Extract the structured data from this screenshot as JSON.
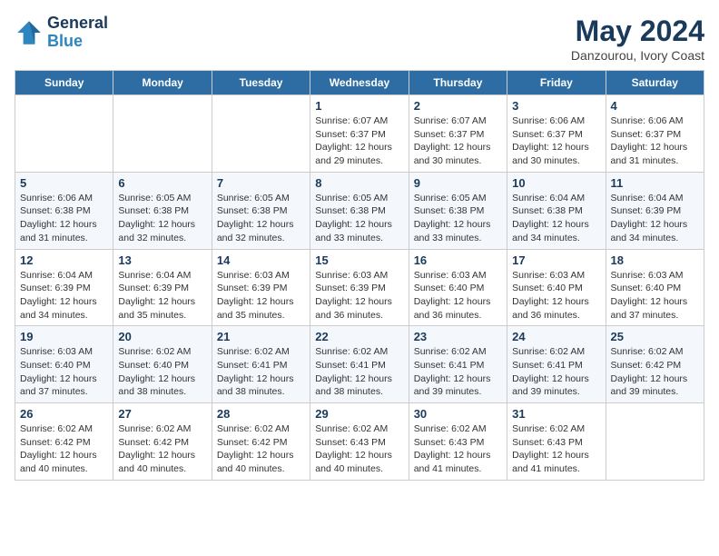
{
  "header": {
    "logo_line1": "General",
    "logo_line2": "Blue",
    "month": "May 2024",
    "location": "Danzourou, Ivory Coast"
  },
  "weekdays": [
    "Sunday",
    "Monday",
    "Tuesday",
    "Wednesday",
    "Thursday",
    "Friday",
    "Saturday"
  ],
  "weeks": [
    [
      {
        "day": "",
        "info": ""
      },
      {
        "day": "",
        "info": ""
      },
      {
        "day": "",
        "info": ""
      },
      {
        "day": "1",
        "info": "Sunrise: 6:07 AM\nSunset: 6:37 PM\nDaylight: 12 hours and 29 minutes."
      },
      {
        "day": "2",
        "info": "Sunrise: 6:07 AM\nSunset: 6:37 PM\nDaylight: 12 hours and 30 minutes."
      },
      {
        "day": "3",
        "info": "Sunrise: 6:06 AM\nSunset: 6:37 PM\nDaylight: 12 hours and 30 minutes."
      },
      {
        "day": "4",
        "info": "Sunrise: 6:06 AM\nSunset: 6:37 PM\nDaylight: 12 hours and 31 minutes."
      }
    ],
    [
      {
        "day": "5",
        "info": "Sunrise: 6:06 AM\nSunset: 6:38 PM\nDaylight: 12 hours and 31 minutes."
      },
      {
        "day": "6",
        "info": "Sunrise: 6:05 AM\nSunset: 6:38 PM\nDaylight: 12 hours and 32 minutes."
      },
      {
        "day": "7",
        "info": "Sunrise: 6:05 AM\nSunset: 6:38 PM\nDaylight: 12 hours and 32 minutes."
      },
      {
        "day": "8",
        "info": "Sunrise: 6:05 AM\nSunset: 6:38 PM\nDaylight: 12 hours and 33 minutes."
      },
      {
        "day": "9",
        "info": "Sunrise: 6:05 AM\nSunset: 6:38 PM\nDaylight: 12 hours and 33 minutes."
      },
      {
        "day": "10",
        "info": "Sunrise: 6:04 AM\nSunset: 6:38 PM\nDaylight: 12 hours and 34 minutes."
      },
      {
        "day": "11",
        "info": "Sunrise: 6:04 AM\nSunset: 6:39 PM\nDaylight: 12 hours and 34 minutes."
      }
    ],
    [
      {
        "day": "12",
        "info": "Sunrise: 6:04 AM\nSunset: 6:39 PM\nDaylight: 12 hours and 34 minutes."
      },
      {
        "day": "13",
        "info": "Sunrise: 6:04 AM\nSunset: 6:39 PM\nDaylight: 12 hours and 35 minutes."
      },
      {
        "day": "14",
        "info": "Sunrise: 6:03 AM\nSunset: 6:39 PM\nDaylight: 12 hours and 35 minutes."
      },
      {
        "day": "15",
        "info": "Sunrise: 6:03 AM\nSunset: 6:39 PM\nDaylight: 12 hours and 36 minutes."
      },
      {
        "day": "16",
        "info": "Sunrise: 6:03 AM\nSunset: 6:40 PM\nDaylight: 12 hours and 36 minutes."
      },
      {
        "day": "17",
        "info": "Sunrise: 6:03 AM\nSunset: 6:40 PM\nDaylight: 12 hours and 36 minutes."
      },
      {
        "day": "18",
        "info": "Sunrise: 6:03 AM\nSunset: 6:40 PM\nDaylight: 12 hours and 37 minutes."
      }
    ],
    [
      {
        "day": "19",
        "info": "Sunrise: 6:03 AM\nSunset: 6:40 PM\nDaylight: 12 hours and 37 minutes."
      },
      {
        "day": "20",
        "info": "Sunrise: 6:02 AM\nSunset: 6:40 PM\nDaylight: 12 hours and 38 minutes."
      },
      {
        "day": "21",
        "info": "Sunrise: 6:02 AM\nSunset: 6:41 PM\nDaylight: 12 hours and 38 minutes."
      },
      {
        "day": "22",
        "info": "Sunrise: 6:02 AM\nSunset: 6:41 PM\nDaylight: 12 hours and 38 minutes."
      },
      {
        "day": "23",
        "info": "Sunrise: 6:02 AM\nSunset: 6:41 PM\nDaylight: 12 hours and 39 minutes."
      },
      {
        "day": "24",
        "info": "Sunrise: 6:02 AM\nSunset: 6:41 PM\nDaylight: 12 hours and 39 minutes."
      },
      {
        "day": "25",
        "info": "Sunrise: 6:02 AM\nSunset: 6:42 PM\nDaylight: 12 hours and 39 minutes."
      }
    ],
    [
      {
        "day": "26",
        "info": "Sunrise: 6:02 AM\nSunset: 6:42 PM\nDaylight: 12 hours and 40 minutes."
      },
      {
        "day": "27",
        "info": "Sunrise: 6:02 AM\nSunset: 6:42 PM\nDaylight: 12 hours and 40 minutes."
      },
      {
        "day": "28",
        "info": "Sunrise: 6:02 AM\nSunset: 6:42 PM\nDaylight: 12 hours and 40 minutes."
      },
      {
        "day": "29",
        "info": "Sunrise: 6:02 AM\nSunset: 6:43 PM\nDaylight: 12 hours and 40 minutes."
      },
      {
        "day": "30",
        "info": "Sunrise: 6:02 AM\nSunset: 6:43 PM\nDaylight: 12 hours and 41 minutes."
      },
      {
        "day": "31",
        "info": "Sunrise: 6:02 AM\nSunset: 6:43 PM\nDaylight: 12 hours and 41 minutes."
      },
      {
        "day": "",
        "info": ""
      }
    ]
  ]
}
